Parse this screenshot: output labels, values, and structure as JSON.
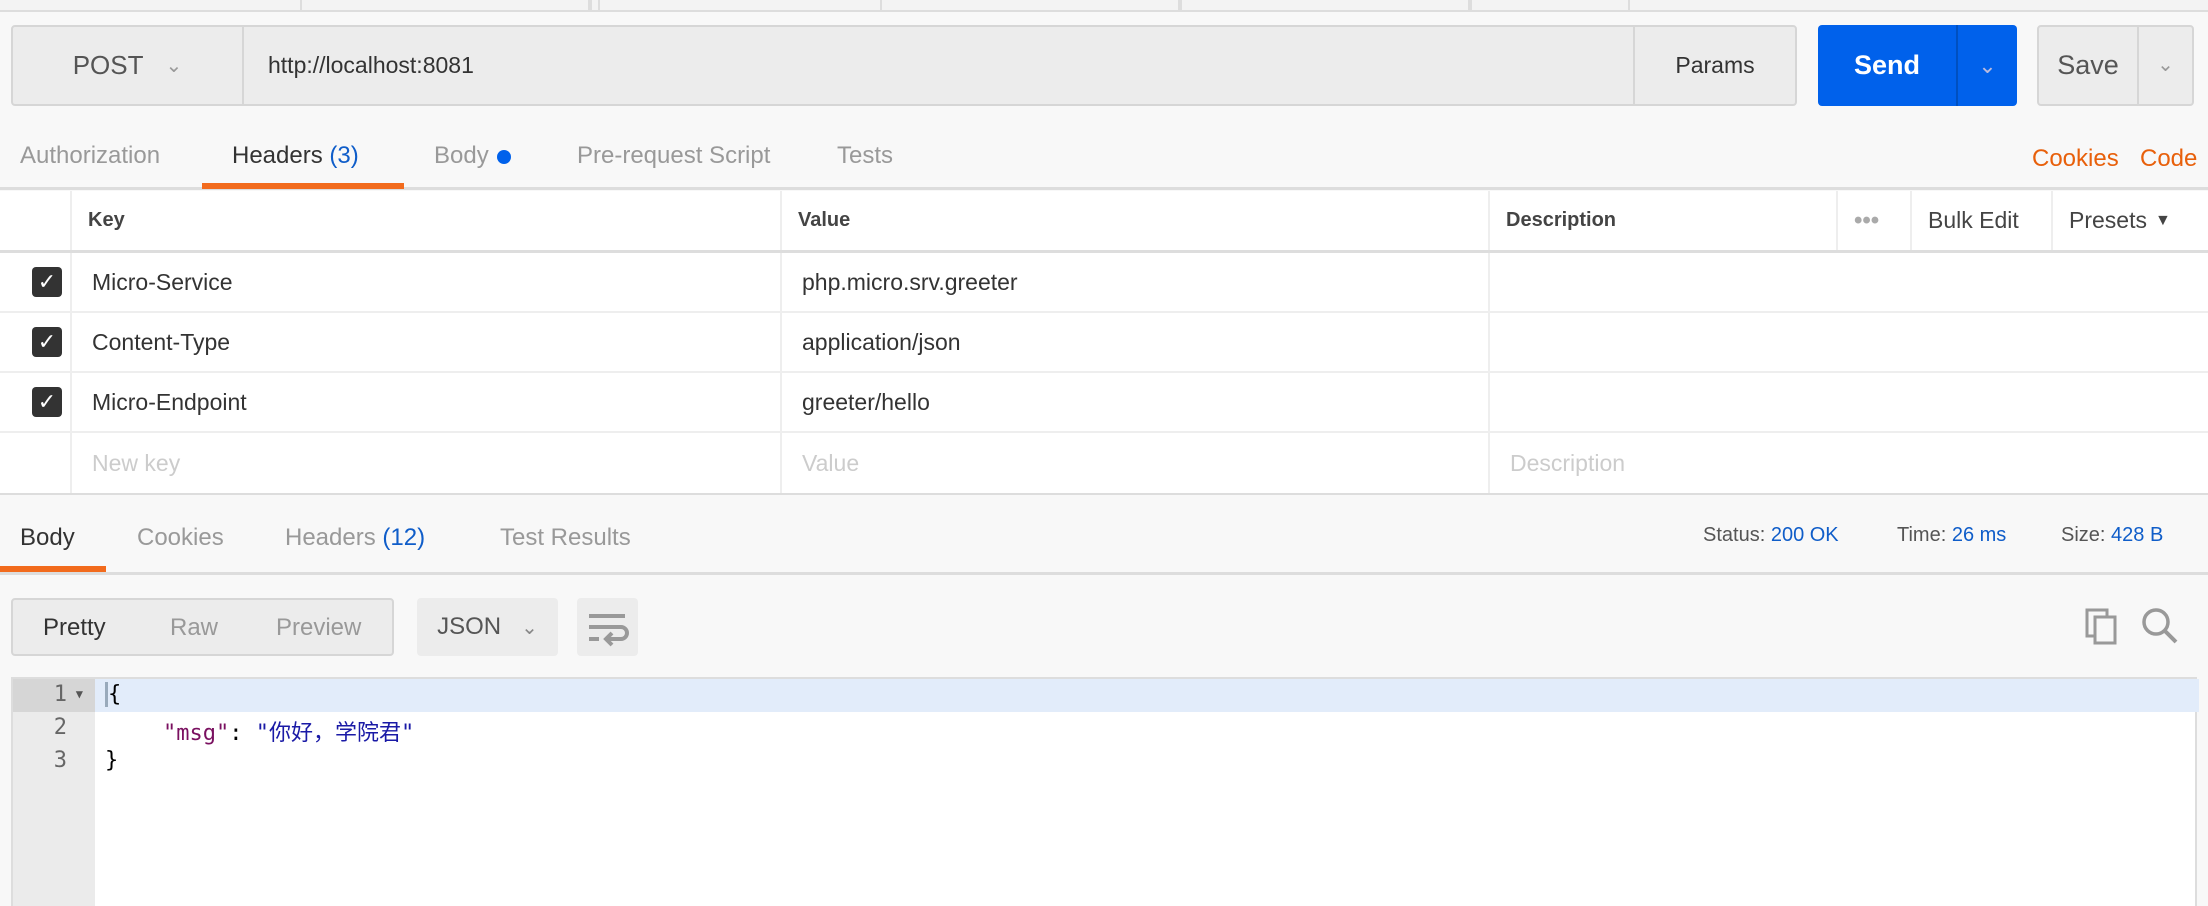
{
  "request": {
    "method": "POST",
    "url": "http://localhost:8081",
    "params_label": "Params",
    "send_label": "Send",
    "save_label": "Save"
  },
  "request_tabs": [
    {
      "label": "Authorization"
    },
    {
      "label": "Headers",
      "count": "(3)"
    },
    {
      "label": "Body"
    },
    {
      "label": "Pre-request Script"
    },
    {
      "label": "Tests"
    }
  ],
  "request_links": {
    "cookies": "Cookies",
    "code": "Code"
  },
  "headers_table": {
    "columns": {
      "key": "Key",
      "value": "Value",
      "description": "Description"
    },
    "bulk_edit": "Bulk Edit",
    "presets": "Presets",
    "rows": [
      {
        "checked": true,
        "key": "Micro-Service",
        "value": "php.micro.srv.greeter",
        "description": ""
      },
      {
        "checked": true,
        "key": "Content-Type",
        "value": "application/json",
        "description": ""
      },
      {
        "checked": true,
        "key": "Micro-Endpoint",
        "value": "greeter/hello",
        "description": ""
      }
    ],
    "placeholders": {
      "key": "New key",
      "value": "Value",
      "description": "Description"
    }
  },
  "response_tabs": [
    {
      "label": "Body"
    },
    {
      "label": "Cookies"
    },
    {
      "label": "Headers",
      "count": "(12)"
    },
    {
      "label": "Test Results"
    }
  ],
  "response_status": {
    "status_label": "Status:",
    "status": "200 OK",
    "time_label": "Time:",
    "time": "26 ms",
    "size_label": "Size:",
    "size": "428 B"
  },
  "view_modes": [
    "Pretty",
    "Raw",
    "Preview"
  ],
  "format": "JSON",
  "editor": {
    "line_numbers": [
      "1",
      "2",
      "3"
    ],
    "open": "{",
    "key": "\"msg\"",
    "colon": ": ",
    "value": "\"你好，学院君\"",
    "close": "}"
  },
  "colors": {
    "accent": "#f26b1d",
    "send": "#0061eb",
    "link": "#0f5dc9"
  }
}
